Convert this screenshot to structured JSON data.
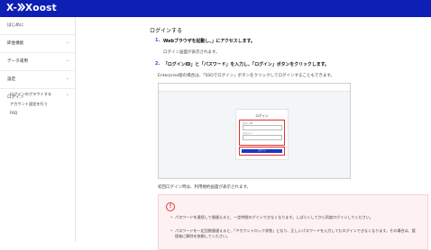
{
  "header": {
    "logo_text": "Xoost",
    "bg_color": "#0d1fb5"
  },
  "sidebar": {
    "items": [
      {
        "label": "はじめに"
      },
      {
        "label": "即金機能"
      },
      {
        "label": "データ運用"
      },
      {
        "label": "設定"
      },
      {
        "label": "ログイン"
      }
    ],
    "sub_items": [
      {
        "label": "ログインのグラウトする"
      },
      {
        "label": "アカウント設定を行う"
      },
      {
        "label": "FAQ"
      }
    ]
  },
  "main": {
    "section_title": "ログインする",
    "steps": [
      {
        "num": "1.",
        "text": "Webブラウザを起動し、」にアクセスします。"
      },
      {
        "num": "2.",
        "text": "「ログインID」と「パスワード」を入力し、「ログイン」ボタンをクリックします。"
      }
    ],
    "step1_note": "ログイン画面が表示されます。",
    "step2_note": "Enterprise版の場合は、「SSOでログイン」ボタンをクリックしてログインすることもできます。",
    "screenshot": {
      "title": "ログイン",
      "id_caption": "ログインID",
      "password_caption": "パスワード",
      "button_label": "ログイン"
    },
    "after_note": "初回ログイン時は、利用規約画面が表示されます。",
    "alert": {
      "icon": "exclamation-icon",
      "bullets": [
        "パスワードを連続して間違えると、一定時間ログインできなくなります。しばらくしてから再度ログインしてください。",
        "パスワードを一定回数間違えると、「アカウントロック状態」となり、正しいパスワードを入力してもログインできなくなります。その場合は、管理者に解除を依頼してください。"
      ]
    },
    "accent_color": "#2a55c9",
    "highlight_color": "#e0302a"
  }
}
